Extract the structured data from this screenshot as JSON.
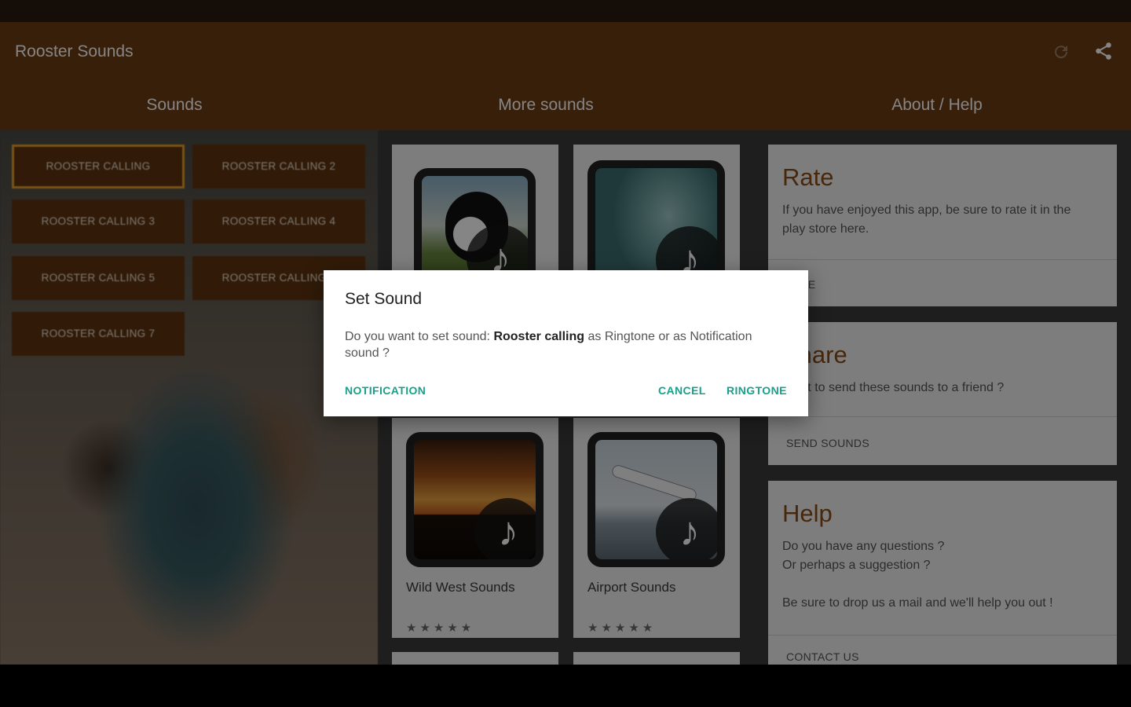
{
  "app": {
    "title": "Rooster Sounds"
  },
  "toolbar": {
    "refresh_icon": "refresh-icon",
    "share_icon": "share-icon"
  },
  "tabs": [
    {
      "label": "Sounds"
    },
    {
      "label": "More sounds"
    },
    {
      "label": "About / Help"
    }
  ],
  "sound_buttons": [
    {
      "label": "ROOSTER CALLING",
      "selected": true
    },
    {
      "label": "ROOSTER CALLING 2"
    },
    {
      "label": "ROOSTER CALLING 3"
    },
    {
      "label": "ROOSTER CALLING 4"
    },
    {
      "label": "ROOSTER CALLING 5"
    },
    {
      "label": "ROOSTER CALLING 6"
    },
    {
      "label": "ROOSTER CALLING 7"
    }
  ],
  "more_sounds": [
    {
      "title": "",
      "stars": "★★★★★"
    },
    {
      "title": "",
      "stars": "★★★★★"
    },
    {
      "title": "Wild West Sounds",
      "stars": "★★★★★"
    },
    {
      "title": "Airport Sounds",
      "stars": "★★★★★"
    }
  ],
  "about": {
    "rate": {
      "title": "Rate",
      "body": "If you have enjoyed this app, be sure to rate it in the play store here.",
      "action": "RATE"
    },
    "share": {
      "title": "Share",
      "body": "Want to send these sounds to a friend ?",
      "action": "SEND SOUNDS"
    },
    "help": {
      "title": "Help",
      "body": "Do you have any questions ?\nOr perhaps a suggestion ?\n\nBe sure to drop us a mail and we'll help you out !",
      "action": "CONTACT US"
    }
  },
  "dialog": {
    "title": "Set Sound",
    "message_prefix": "Do you want to set sound: ",
    "sound_name": "Rooster calling",
    "message_suffix": " as Ringtone or as Notification sound ?",
    "notification_label": "NOTIFICATION",
    "cancel_label": "CANCEL",
    "ringtone_label": "RINGTONE"
  },
  "colors": {
    "brand": "#6b3d15",
    "accent": "#17a08a",
    "button": "#5e3411",
    "selected_border": "#e6a02a"
  }
}
